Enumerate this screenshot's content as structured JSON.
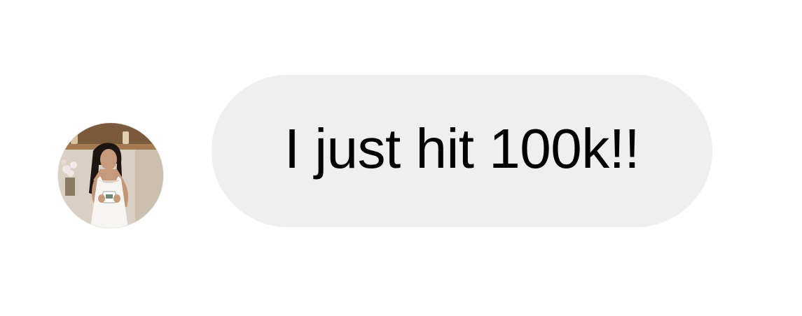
{
  "conversation": {
    "messages": [
      {
        "sender_avatar": "profile-photo",
        "text": "I just hit 100k!!"
      }
    ]
  },
  "colors": {
    "background": "#ffffff",
    "bubble": "#efefef",
    "text": "#000000"
  }
}
